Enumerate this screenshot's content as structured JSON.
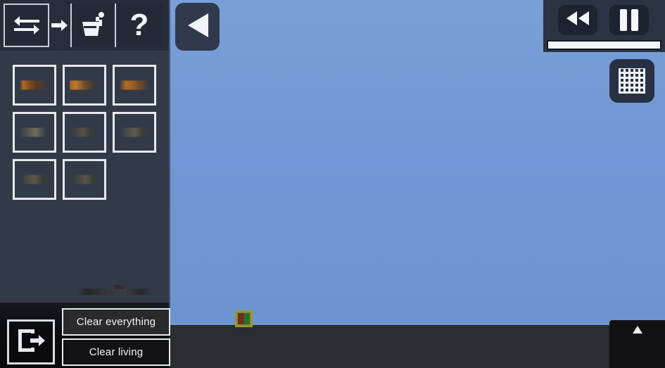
{
  "app": {
    "title": "Sandbox Game Editor",
    "colors": {
      "sky": "#7198d4",
      "ground": "#2b2d31",
      "sidebar": "#333a47",
      "toolbar": "#272e3a",
      "accent_white": "#f2f4f8",
      "button_dark": "#1d232f",
      "crate_yellow": "#8a8a2e"
    }
  },
  "toolbar": {
    "buttons": [
      {
        "name": "swap-tool",
        "icon": "swap-arrows-icon",
        "label": ""
      },
      {
        "name": "move-tool",
        "icon": "arrow-right-icon",
        "label": ""
      },
      {
        "name": "paint-tool",
        "icon": "paint-bucket-icon",
        "label": ""
      },
      {
        "name": "help-tool",
        "icon": "question-mark-icon",
        "label": "?"
      }
    ],
    "help_glyph": "?"
  },
  "inventory": {
    "slots": [
      {
        "name": "weapon-slot-1",
        "icon": "pistol-icon",
        "style": "gun-a"
      },
      {
        "name": "weapon-slot-2",
        "icon": "submachine-gun-icon",
        "style": "gun-b"
      },
      {
        "name": "weapon-slot-3",
        "icon": "revolver-icon",
        "style": "gun-c"
      },
      {
        "name": "weapon-slot-4",
        "icon": "smg-icon",
        "style": "gun-d"
      },
      {
        "name": "weapon-slot-5",
        "icon": "rifle-icon",
        "style": "gun-e"
      },
      {
        "name": "weapon-slot-6",
        "icon": "shotgun-icon",
        "style": "gun-f"
      },
      {
        "name": "weapon-slot-7",
        "icon": "sniper-rifle-icon",
        "style": "gun-g"
      },
      {
        "name": "weapon-slot-8",
        "icon": "assault-rifle-icon",
        "style": "gun-h"
      }
    ],
    "selected_index": 0
  },
  "sidebar_actions": {
    "exit_icon": "exit-door-icon",
    "clear_everything_label": "Clear everything",
    "clear_living_label": "Clear living"
  },
  "navigation": {
    "back_icon": "back-triangle-icon"
  },
  "playback": {
    "rewind_icon": "rewind-icon",
    "pause_icon": "pause-icon",
    "speed_slider_value": 100
  },
  "viewport": {
    "grid_toggle_icon": "grid-icon",
    "expand_icon": "expand-up-icon",
    "object": {
      "name": "crate-entity",
      "icon": "crate-icon"
    }
  }
}
